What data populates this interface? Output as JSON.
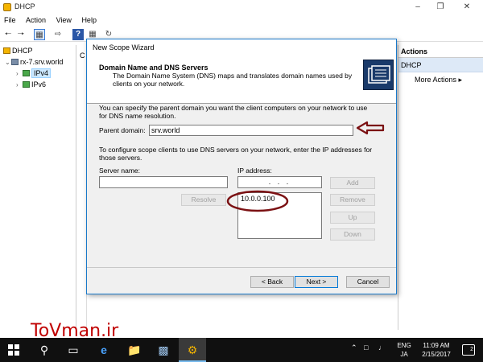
{
  "window": {
    "title": "DHCP"
  },
  "menu": [
    "File",
    "Action",
    "View",
    "Help"
  ],
  "tree": {
    "root": "DHCP",
    "server": "rx-7.srv.world",
    "ipv4": "IPv4",
    "ipv6": "IPv6"
  },
  "center_strip": {
    "letter": "C"
  },
  "actions_pane": {
    "header": "Actions",
    "section": "DHCP",
    "more_actions": "More Actions"
  },
  "wizard": {
    "title": "New Scope Wizard",
    "heading": "Domain Name and DNS Servers",
    "subheading": "The Domain Name System (DNS) maps and translates domain names used by clients on your network.",
    "parent_intro": "You can specify the parent domain you want the client computers on your network to use for DNS name resolution.",
    "parent_domain_label": "Parent domain:",
    "parent_domain_value": "srv.world",
    "dns_intro": "To configure scope clients to use DNS servers on your network, enter the IP addresses for those servers.",
    "server_name_label": "Server name:",
    "server_name_value": "",
    "ip_label": "IP address:",
    "ip_value": ".   .   .",
    "ip_list": [
      "10.0.0.100"
    ],
    "buttons": {
      "add": "Add",
      "resolve": "Resolve",
      "remove": "Remove",
      "up": "Up",
      "down": "Down",
      "back": "< Back",
      "next": "Next >",
      "cancel": "Cancel"
    }
  },
  "watermark": "ToVman.ir",
  "taskbar": {
    "lang_top": "ENG",
    "lang_bottom": "JA",
    "time": "11:09 AM",
    "date": "2/15/2017",
    "notification_count": "2"
  },
  "colors": {
    "annotation": "#7b1113",
    "accent": "#0078d7",
    "taskbar": "#101010",
    "watermark": "#c00000"
  }
}
